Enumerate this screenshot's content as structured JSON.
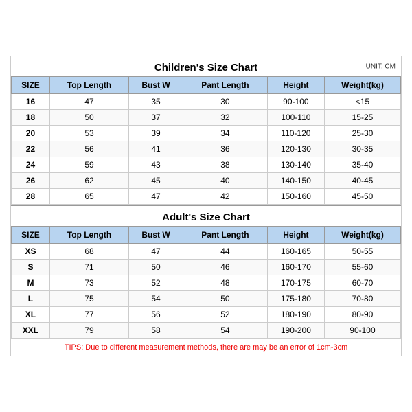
{
  "children": {
    "title": "Children's Size Chart",
    "unit": "UNIT: CM",
    "headers": [
      "SIZE",
      "Top Length",
      "Bust W",
      "Pant Length",
      "Height",
      "Weight(kg)"
    ],
    "rows": [
      [
        "16",
        "47",
        "35",
        "30",
        "90-100",
        "<15"
      ],
      [
        "18",
        "50",
        "37",
        "32",
        "100-110",
        "15-25"
      ],
      [
        "20",
        "53",
        "39",
        "34",
        "110-120",
        "25-30"
      ],
      [
        "22",
        "56",
        "41",
        "36",
        "120-130",
        "30-35"
      ],
      [
        "24",
        "59",
        "43",
        "38",
        "130-140",
        "35-40"
      ],
      [
        "26",
        "62",
        "45",
        "40",
        "140-150",
        "40-45"
      ],
      [
        "28",
        "65",
        "47",
        "42",
        "150-160",
        "45-50"
      ]
    ]
  },
  "adult": {
    "title": "Adult's Size Chart",
    "headers": [
      "SIZE",
      "Top Length",
      "Bust W",
      "Pant Length",
      "Height",
      "Weight(kg)"
    ],
    "rows": [
      [
        "XS",
        "68",
        "47",
        "44",
        "160-165",
        "50-55"
      ],
      [
        "S",
        "71",
        "50",
        "46",
        "160-170",
        "55-60"
      ],
      [
        "M",
        "73",
        "52",
        "48",
        "170-175",
        "60-70"
      ],
      [
        "L",
        "75",
        "54",
        "50",
        "175-180",
        "70-80"
      ],
      [
        "XL",
        "77",
        "56",
        "52",
        "180-190",
        "80-90"
      ],
      [
        "XXL",
        "79",
        "58",
        "54",
        "190-200",
        "90-100"
      ]
    ]
  },
  "tips": "TIPS: Due to different measurement methods, there are may be an error of 1cm-3cm"
}
